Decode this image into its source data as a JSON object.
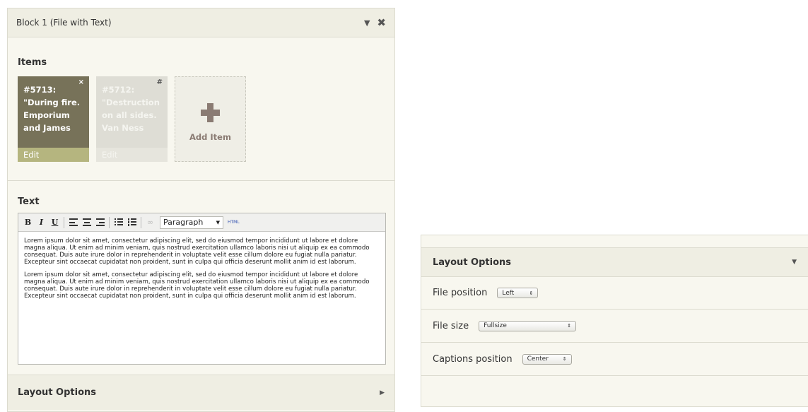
{
  "block": {
    "title": "Block 1 (File with Text)",
    "collapse_icon": "triangle-down-icon",
    "close_icon": "close-icon",
    "items_title": "Items",
    "items": [
      {
        "text": "#5713: \"During fire. Emporium and James",
        "edit": "Edit",
        "badge": "×"
      },
      {
        "text": "#5712: \"Destruction on all sides. Van Ness",
        "edit": "Edit",
        "badge": "#"
      }
    ],
    "add_item_label": "Add Item",
    "text_title": "Text",
    "toolbar": {
      "bold": "B",
      "italic": "I",
      "underline": "U",
      "format_select": "Paragraph",
      "html_label": "HTML"
    },
    "paragraphs": [
      "Lorem ipsum dolor sit amet, consectetur adipiscing elit, sed do eiusmod tempor incididunt ut labore et dolore magna aliqua. Ut enim ad minim veniam, quis nostrud exercitation ullamco laboris nisi ut aliquip ex ea commodo consequat. Duis aute irure dolor in reprehenderit in voluptate velit esse cillum dolore eu fugiat nulla pariatur. Excepteur sint occaecat cupidatat non proident, sunt in culpa qui officia deserunt mollit anim id est laborum.",
      "Lorem ipsum dolor sit amet, consectetur adipiscing elit, sed do eiusmod tempor incididunt ut labore et dolore magna aliqua. Ut enim ad minim veniam, quis nostrud exercitation ullamco laboris nisi ut aliquip ex ea commodo consequat. Duis aute irure dolor in reprehenderit in voluptate velit esse cillum dolore eu fugiat nulla pariatur. Excepteur sint occaecat cupidatat non proident, sunt in culpa qui officia deserunt mollit anim id est laborum."
    ],
    "layout_title": "Layout Options"
  },
  "layout_panel": {
    "title": "Layout Options",
    "rows": [
      {
        "label": "File position",
        "value": "Left"
      },
      {
        "label": "File size",
        "value": "Fullsize"
      },
      {
        "label": "Captions position",
        "value": "Center"
      }
    ]
  },
  "colors": {
    "tile_active": "#777259",
    "tile_edit": "#b5b57f",
    "panel_bg": "#f8f7ef",
    "header_bg": "#efeee3",
    "add_icon": "#8a7b73"
  }
}
